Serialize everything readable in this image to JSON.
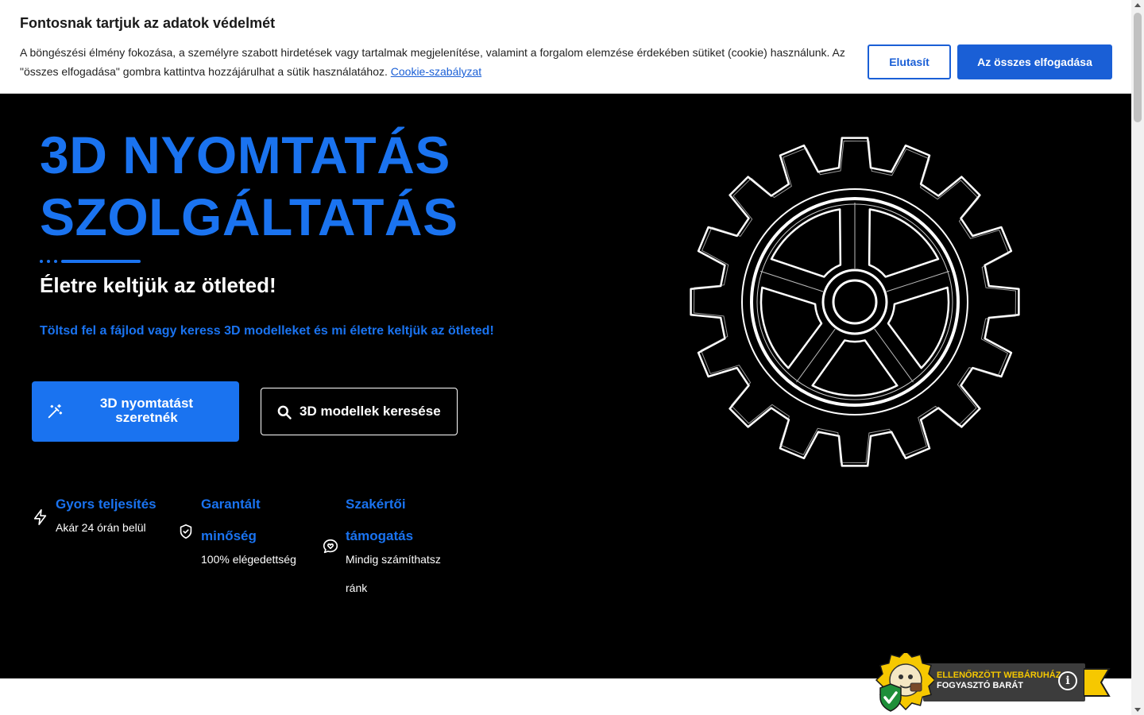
{
  "cookie": {
    "title": "Fontosnak tartjuk az adatok védelmét",
    "text": "A böngészési élmény fokozása, a személyre szabott hirdetések vagy tartalmak megjelenítése, valamint a forgalom elemzése érdekében sütiket (cookie) használunk. Az \"összes elfogadása\" gombra kattintva hozzájárulhat a sütik használatához.",
    "link": "Cookie-szabályzat",
    "reject_label": "Elutasít",
    "accept_label": "Az összes elfogadása"
  },
  "hero": {
    "title_line1": "3D NYOMTATÁS",
    "title_line2": "SZOLGÁLTATÁS",
    "subtitle": "Életre keltjük az ötleted!",
    "description": "Töltsd fel a fájlod vagy keress 3D modelleket és mi életre keltjük az ötleted!",
    "primary_button_line1": "3D nyomtatást",
    "primary_button_line2": "szeretnék",
    "secondary_button": "3D modellek keresése",
    "accent_color": "#1a73f0",
    "background_color": "#000000"
  },
  "features": [
    {
      "title_line1": "Gyors teljesítés",
      "title_line2": "",
      "desc_line1": "Akár 24 órán belül",
      "desc_line2": "",
      "icon": "lightning-icon"
    },
    {
      "title_line1": "Garantált",
      "title_line2": "minőség",
      "desc_line1": "100% elégedettség",
      "desc_line2": "",
      "icon": "shield-check-icon"
    },
    {
      "title_line1": "Szakértői",
      "title_line2": "támogatás",
      "desc_line1": "Mindig számíthatsz",
      "desc_line2": "ránk",
      "icon": "chat-heart-icon"
    }
  ],
  "badge": {
    "line1": "ELLENŐRZÖTT WEBÁRUHÁZ",
    "line2": "FOGYASZTÓ BARÁT",
    "info": "i"
  }
}
